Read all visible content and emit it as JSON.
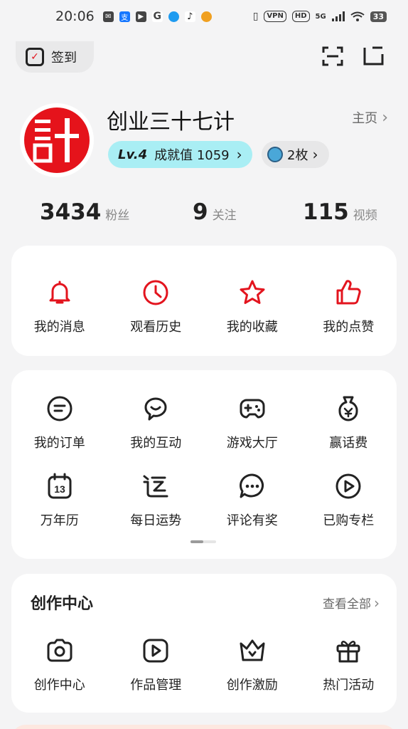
{
  "status_bar": {
    "time": "20:06",
    "network_vpn": "VPN",
    "network_hd": "HD",
    "network_5g": "5G",
    "battery": "33"
  },
  "header": {
    "checkin_label": "签到"
  },
  "profile": {
    "nickname": "创业三十七计",
    "homepage_label": "主页",
    "level": "Lv.4",
    "achievement_label": "成就值 1059",
    "medal_count": "2枚",
    "stats": [
      {
        "value": "3434",
        "label": "粉丝"
      },
      {
        "value": "9",
        "label": "关注"
      },
      {
        "value": "115",
        "label": "视频"
      }
    ]
  },
  "quick_actions": [
    {
      "label": "我的消息",
      "icon": "bell-icon"
    },
    {
      "label": "观看历史",
      "icon": "clock-icon"
    },
    {
      "label": "我的收藏",
      "icon": "star-icon"
    },
    {
      "label": "我的点赞",
      "icon": "thumbs-up-icon"
    }
  ],
  "services": {
    "row1": [
      {
        "label": "我的订单",
        "icon": "order-icon"
      },
      {
        "label": "我的互动",
        "icon": "chat-smile-icon"
      },
      {
        "label": "游戏大厅",
        "icon": "gamepad-icon"
      },
      {
        "label": "赢话费",
        "icon": "money-bag-icon"
      }
    ],
    "row2": [
      {
        "label": "万年历",
        "icon": "calendar-icon"
      },
      {
        "label": "每日运势",
        "icon": "fortune-icon"
      },
      {
        "label": "评论有奖",
        "icon": "comment-icon"
      },
      {
        "label": "已购专栏",
        "icon": "play-icon"
      }
    ]
  },
  "creator_center": {
    "title": "创作中心",
    "view_all": "查看全部",
    "items": [
      {
        "label": "创作中心",
        "icon": "camera-icon"
      },
      {
        "label": "作品管理",
        "icon": "video-icon"
      },
      {
        "label": "创作激励",
        "icon": "crown-icon"
      },
      {
        "label": "热门活动",
        "icon": "gift-icon"
      }
    ]
  },
  "colors": {
    "accent_red": "#e3141e",
    "level_badge_bg": "#a9eef4",
    "page_bg": "#f4f4f5"
  }
}
